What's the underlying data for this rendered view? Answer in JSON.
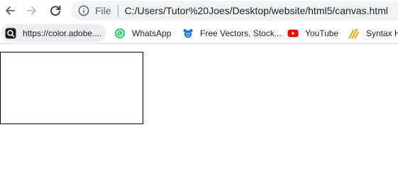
{
  "browser": {
    "scheme_label": "File",
    "url": "C:/Users/Tutor%20Joes/Desktop/website/html5/canvas.html"
  },
  "bookmarks": [
    {
      "label": "https://color.adobe....",
      "icon": "adobe-color-icon"
    },
    {
      "label": "WhatsApp",
      "icon": "whatsapp-icon"
    },
    {
      "label": "Free Vectors, Stock...",
      "icon": "freepik-icon"
    },
    {
      "label": "YouTube",
      "icon": "youtube-icon"
    },
    {
      "label": "Syntax H",
      "icon": "syntax-highlighter-icon"
    }
  ],
  "colors": {
    "toolbar_background": "#f1f3f4",
    "canvas_border": "#000000",
    "whatsapp": "#25d366",
    "youtube": "#ff0000",
    "freepik": "#1273eb",
    "syntax": "#f5a623"
  }
}
